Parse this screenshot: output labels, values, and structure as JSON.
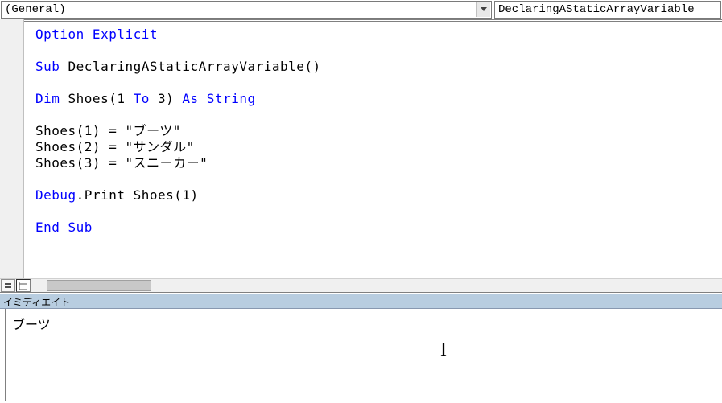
{
  "dropdowns": {
    "object": "(General)",
    "procedure": "DeclaringAStaticArrayVariable"
  },
  "code": {
    "l1_option": "Option Explicit",
    "l2_sub": "Sub ",
    "l2_name": "DeclaringAStaticArrayVariable()",
    "l3_dim": "Dim ",
    "l3_var": "Shoes(1 ",
    "l3_to": "To ",
    "l3_bound": "3) ",
    "l3_as": "As String",
    "l4a": "Shoes(1) = \"ブーツ\"",
    "l4b": "Shoes(2) = \"サンダル\"",
    "l4c": "Shoes(3) = \"スニーカー\"",
    "l5_dbg": "Debug",
    "l5_print": ".Print ",
    "l5_arg": "Shoes(1)",
    "l6_end": "End Sub"
  },
  "immediate": {
    "title": "イミディエイト",
    "output": "ブーツ"
  }
}
